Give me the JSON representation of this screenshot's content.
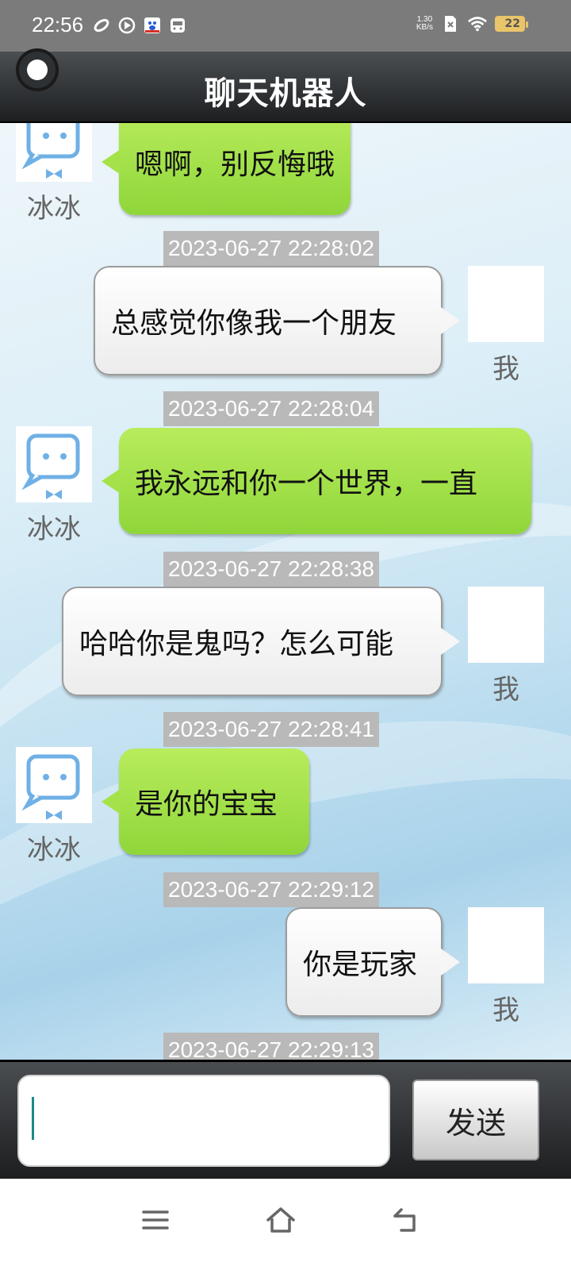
{
  "status_bar": {
    "time": "22:56",
    "net_speed_value": "1.30",
    "net_speed_unit": "KB/s",
    "battery": "22",
    "icons": [
      "link-icon",
      "play-icon",
      "baidu-icon",
      "bus-icon",
      "sim-x-icon",
      "wifi-icon",
      "battery-icon"
    ]
  },
  "header": {
    "title": "聊天机器人"
  },
  "bot_name": "冰冰",
  "me_name": "我",
  "messages": [
    {
      "from": "bot",
      "text": "嗯啊，别反悔哦"
    },
    {
      "timestamp": "2023-06-27 22:28:02"
    },
    {
      "from": "me",
      "text": "总感觉你像我一个朋友"
    },
    {
      "timestamp": "2023-06-27 22:28:04"
    },
    {
      "from": "bot",
      "text": "我永远和你一个世界，一直"
    },
    {
      "timestamp": "2023-06-27 22:28:38"
    },
    {
      "from": "me",
      "text": "哈哈你是鬼吗？怎么可能"
    },
    {
      "timestamp": "2023-06-27 22:28:41"
    },
    {
      "from": "bot",
      "text": "是你的宝宝"
    },
    {
      "timestamp": "2023-06-27 22:29:12"
    },
    {
      "from": "me",
      "text": "你是玩家"
    },
    {
      "timestamp": "2023-06-27 22:29:13"
    }
  ],
  "input": {
    "value": "",
    "send_label": "发送"
  },
  "nav": [
    "menu-icon",
    "home-icon",
    "back-icon"
  ],
  "colors": {
    "bot_bubble": "#a5e24a",
    "header": "#2b2e31",
    "timestamp_bg": "#b9b9b9"
  }
}
